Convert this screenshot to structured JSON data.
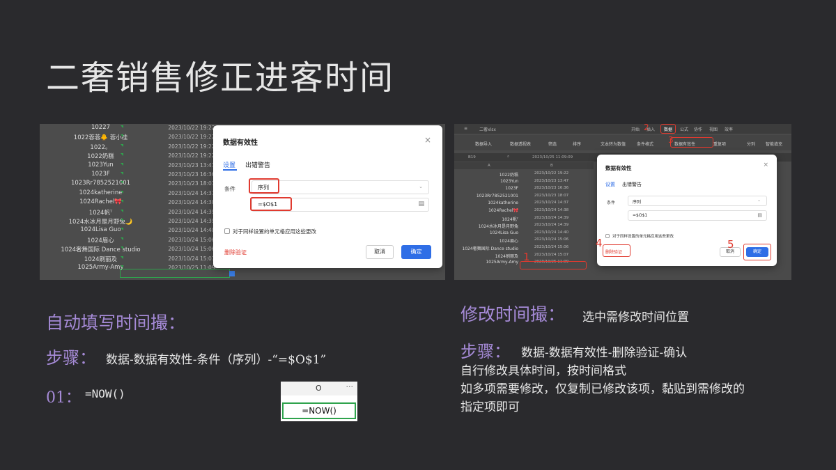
{
  "title": "二奢销售修正进客时间",
  "left_screenshot": {
    "rows": [
      {
        "name": "10227",
        "time": "2023/10/22 19:22"
      },
      {
        "name": "1022蓉蓉🐥 蓉小桂",
        "time": "2023/10/22 19:22"
      },
      {
        "name": "1022。",
        "time": "2023/10/22 19:22"
      },
      {
        "name": "1022奶糕",
        "time": "2023/10/22 19:22"
      },
      {
        "name": "1023Yun",
        "time": "2023/10/23 13:47"
      },
      {
        "name": "1023F",
        "time": "2023/10/23 16:36"
      },
      {
        "name": "1023Rr7852521001",
        "time": "2023/10/23 18:07"
      },
      {
        "name": "1024katherine",
        "time": "2023/10/24 14:37"
      },
      {
        "name": "1024Rachel🎀",
        "time": "2023/10/24 14:38"
      },
      {
        "name": "1024帆ᵀ",
        "time": "2023/10/24 14:39"
      },
      {
        "name": "1024水冰月是月野兔🌙",
        "time": "2023/10/24 14:39"
      },
      {
        "name": "1024Lisa Guo",
        "time": "2023/10/24 14:40"
      },
      {
        "name": "1024眉心",
        "time": "2023/10/24 15:06"
      },
      {
        "name": "1024奢舞国际 Dance studio",
        "time": "2023/10/24 15:06"
      },
      {
        "name": "1024刷丽及",
        "time": "2023/10/24 15:07"
      },
      {
        "name": "1025Army-Amy",
        "time": "2023/10/25 11:09"
      }
    ],
    "dialog": {
      "title": "数据有效性",
      "close": "×",
      "tab_settings": "设置",
      "tab_error": "出错警告",
      "condition_label": "条件",
      "condition_value": "序列",
      "formula_value": "=$O$1",
      "checkbox_label": "对于同样设置的单元格应用这些更改",
      "delete_link": "删除验证",
      "cancel": "取消",
      "ok": "确定"
    }
  },
  "right_screenshot": {
    "menu": [
      "开始",
      "插入",
      "数据",
      "公式",
      "协作",
      "视图",
      "效率"
    ],
    "active_menu": "数据",
    "doc_name": "二奢xlsx",
    "toolbar": [
      "数据导入",
      "数据透视表",
      "筛选",
      "排序",
      "文本转为数值",
      "条件格式",
      "数据有效性",
      "重复项",
      "分列",
      "智能填充"
    ],
    "cell_ref": "B19",
    "cell_value": "2023/10/25 11:09:09",
    "col_a": "A",
    "col_b": "B",
    "rows": [
      {
        "name": "1022奶糕",
        "time": "2023/10/22 19:22"
      },
      {
        "name": "1023Yun",
        "time": "2023/10/23 13:47"
      },
      {
        "name": "1023F",
        "time": "2023/10/23 16:36"
      },
      {
        "name": "1023Rr7852521001",
        "time": "2023/10/23 18:07"
      },
      {
        "name": "1024katherine",
        "time": "2023/10/24 14:37"
      },
      {
        "name": "1024Rachel🎀",
        "time": "2023/10/24 14:38"
      },
      {
        "name": "1024帆ᵀ",
        "time": "2023/10/24 14:39"
      },
      {
        "name": "1024水冰月是月野兔",
        "time": "2023/10/24 14:39"
      },
      {
        "name": "1024Lisa Guo",
        "time": "2023/10/24 14:40"
      },
      {
        "name": "1024眉心",
        "time": "2023/10/24 15:06"
      },
      {
        "name": "1024奢舞国际 Dance studio",
        "time": "2023/10/24 15:06"
      },
      {
        "name": "1024刷丽及",
        "time": "2023/10/24 15:07"
      },
      {
        "name": "1025Army-Amy",
        "time": "2023/10/25 11:09"
      }
    ],
    "dialog": {
      "title": "数据有效性",
      "close": "×",
      "tab_settings": "设置",
      "tab_error": "出错警告",
      "condition_label": "条件",
      "condition_value": "序列",
      "formula_value": "=$O$1",
      "checkbox_label": "对于同样设置的单元格应用这些更改",
      "delete_link": "删除验证",
      "cancel": "取消",
      "ok": "确定"
    },
    "step_numbers": [
      "1",
      "2",
      "3",
      "4",
      "5"
    ]
  },
  "section_left": {
    "heading": "自动填写时间撮：",
    "steps_label": "步骤：",
    "steps_text": "数据-数据有效性-条件（序列）-“=$O$1”",
    "item_label": "01：",
    "item_text": "=NOW()"
  },
  "mini_cell": {
    "column": "O",
    "dots": "···",
    "formula": "=NOW()"
  },
  "section_right": {
    "heading": "修改时间撮：",
    "heading_note": "选中需修改时间位置",
    "steps_label": "步骤：",
    "steps_text": "数据-数据有效性-删除验证-确认",
    "line1": "自行修改具体时间，按时间格式",
    "line2": "如多项需要修改，仅复制已修改该项，黏贴到需修改的",
    "line3": "指定项即可"
  },
  "colors": {
    "background": "#2a2a2d",
    "heading": "#a58ad6",
    "highlight": "#e03a2f",
    "primary_button": "#2f6ee6",
    "selection": "#2fa34d"
  }
}
